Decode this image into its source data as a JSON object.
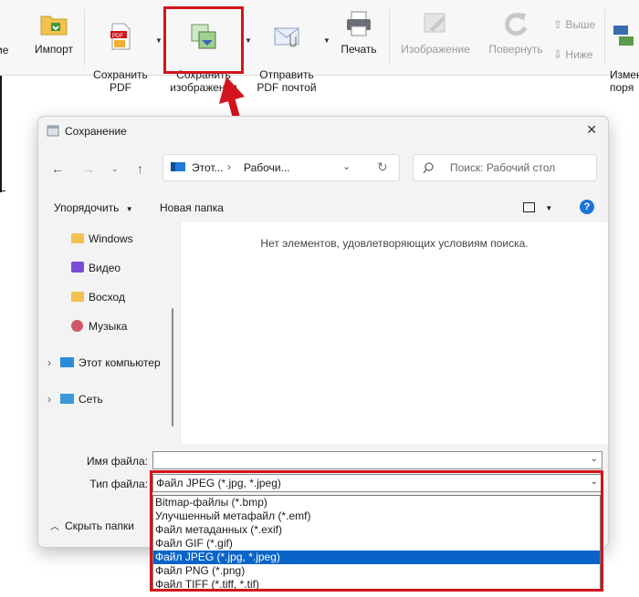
{
  "toolbar": {
    "items": [
      {
        "label": "ие"
      },
      {
        "label": "Импорт"
      },
      {
        "label": "Сохранить\nPDF"
      },
      {
        "label": "Сохранить\nизображения"
      },
      {
        "label": "Отправить\nPDF почтой"
      },
      {
        "label": "Печать"
      },
      {
        "label": "Изображение"
      },
      {
        "label": "Повернуть"
      },
      {
        "label": "Выше"
      },
      {
        "label": "Ниже"
      },
      {
        "label": "Измен\nпоря"
      }
    ]
  },
  "dialog": {
    "title": "Сохранение",
    "breadcrumb": [
      "Этот...",
      "Рабочи..."
    ],
    "search_placeholder": "Поиск: Рабочий стол",
    "organize_label": "Упорядочить",
    "new_folder_label": "Новая папка",
    "nav_items": [
      {
        "label": "Windows",
        "icon": "folder-icon"
      },
      {
        "label": "Видео",
        "icon": "video-icon"
      },
      {
        "label": "Восход",
        "icon": "folder-icon"
      },
      {
        "label": "Музыка",
        "icon": "music-icon"
      },
      {
        "label": "Этот компьютер",
        "icon": "computer-icon"
      },
      {
        "label": "Сеть",
        "icon": "network-icon"
      }
    ],
    "empty_message": "Нет элементов, удовлетворяющих условиям поиска.",
    "filename_label": "Имя файла:",
    "filename_value": "",
    "filetype_label": "Тип файла:",
    "filetype_value": "Файл JPEG (*.jpg, *.jpeg)",
    "hide_folders_label": "Скрыть папки",
    "filetype_options": [
      "Bitmap-файлы (*.bmp)",
      "Улучшенный метафайл (*.emf)",
      "Файл метаданных (*.exif)",
      "Файл GIF (*.gif)",
      "Файл JPEG (*.jpg, *.jpeg)",
      "Файл PNG (*.png)",
      "Файл TIFF (*.tiff, *.tif)"
    ],
    "selected_option_index": 4
  },
  "colors": {
    "accent": "#0a64c8",
    "highlight": "#d3141c",
    "help": "#1a73d8"
  }
}
